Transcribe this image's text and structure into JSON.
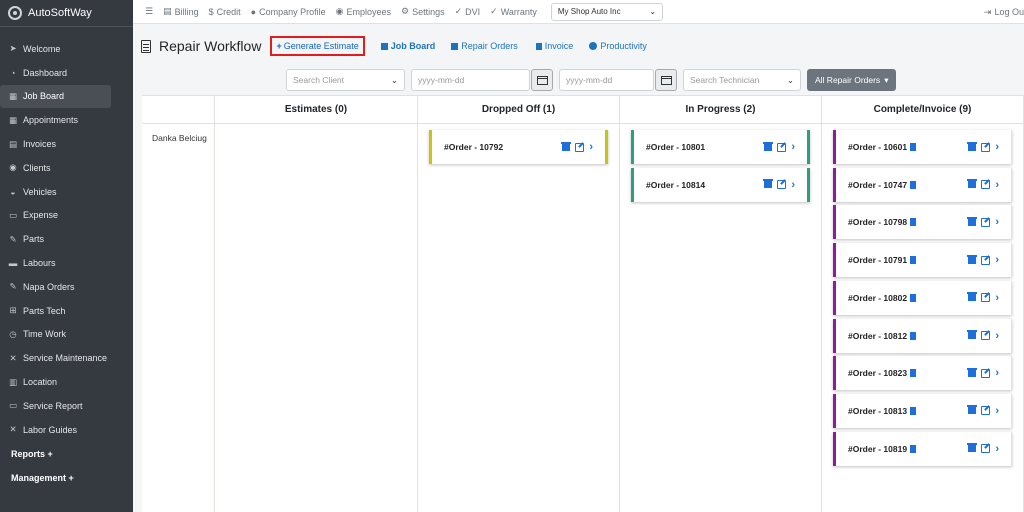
{
  "app": {
    "brand": "AutoSoftWay"
  },
  "sidebar": {
    "items": [
      {
        "label": "Welcome",
        "icon": "rocket-icon"
      },
      {
        "label": "Dashboard",
        "icon": "gauge-icon"
      },
      {
        "label": "Job Board",
        "icon": "calendar-icon",
        "active": true
      },
      {
        "label": "Appointments",
        "icon": "calendar-icon"
      },
      {
        "label": "Invoices",
        "icon": "file-icon"
      },
      {
        "label": "Clients",
        "icon": "users-icon"
      },
      {
        "label": "Vehicles",
        "icon": "car-icon"
      },
      {
        "label": "Expense",
        "icon": "money-icon"
      },
      {
        "label": "Parts",
        "icon": "wrench-icon"
      },
      {
        "label": "Labours",
        "icon": "toolbox-icon"
      },
      {
        "label": "Napa Orders",
        "icon": "wrench-icon"
      },
      {
        "label": "Parts Tech",
        "icon": "sitemap-icon"
      },
      {
        "label": "Time Work",
        "icon": "clock-icon"
      },
      {
        "label": "Service Maintenance",
        "icon": "tools-icon"
      },
      {
        "label": "Location",
        "icon": "map-icon"
      },
      {
        "label": "Service Report",
        "icon": "money-icon"
      },
      {
        "label": "Labor Guides",
        "icon": "tools-icon"
      }
    ],
    "sections": [
      "Reports +",
      "Management +"
    ]
  },
  "topbar": {
    "items": [
      {
        "label": "Billing",
        "icon": "billing-icon"
      },
      {
        "label": "Credit",
        "icon": "dollar-icon"
      },
      {
        "label": "Company Profile",
        "icon": "user-icon"
      },
      {
        "label": "Employees",
        "icon": "users-icon"
      },
      {
        "label": "Settings",
        "icon": "gear-icon"
      },
      {
        "label": "DVI",
        "icon": "check-icon"
      },
      {
        "label": "Warranty",
        "icon": "check-double-icon"
      }
    ],
    "shop_select": "My Shop Auto Inc",
    "logout": "Log Ou"
  },
  "header": {
    "title": "Repair Workflow",
    "generate_estimate": "Generate Estimate",
    "links": {
      "job_board": "Job Board",
      "repair_orders": "Repair Orders",
      "invoice": "Invoice",
      "productivity": "Productivity"
    }
  },
  "filters": {
    "client_placeholder": "Search Client",
    "date_from_placeholder": "yyyy-mm-dd",
    "date_to_placeholder": "yyyy-mm-dd",
    "technician_placeholder": "Search Technician",
    "repair_orders_btn": "All Repair Orders"
  },
  "board": {
    "row_label": "Danka Belciug",
    "columns": [
      {
        "title": "Estimates (0)",
        "color": "#cccccc",
        "cards": []
      },
      {
        "title": "Dropped Off (1)",
        "color": "#c9c217",
        "cards": [
          "#Order - 10792"
        ]
      },
      {
        "title": "In Progress (2)",
        "color": "#2e9e7e",
        "cards": [
          "#Order - 10801",
          "#Order - 10814"
        ]
      },
      {
        "title": "Complete/Invoice (9)",
        "color": "#8e1aa0",
        "cards": [
          "#Order - 10601",
          "#Order - 10747",
          "#Order - 10798",
          "#Order - 10791",
          "#Order - 10802",
          "#Order - 10812",
          "#Order - 10823",
          "#Order - 10813",
          "#Order - 10819"
        ]
      }
    ]
  }
}
